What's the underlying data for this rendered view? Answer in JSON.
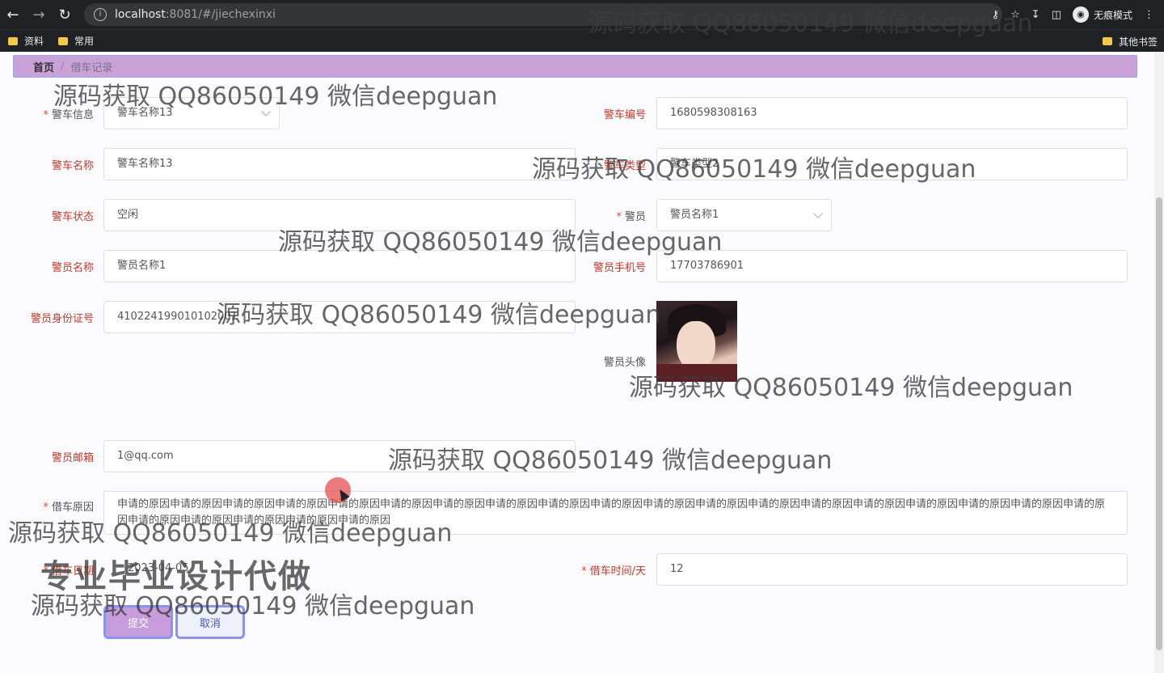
{
  "browser": {
    "url_host": "localhost",
    "url_path": ":8081/#/jiechexinxi",
    "incognito_label": "无痕模式",
    "bookmarks": [
      "资料",
      "常用"
    ],
    "other_bookmarks": "其他书签"
  },
  "breadcrumb": {
    "home": "首页",
    "separator": "/",
    "current": "借车记录"
  },
  "form": {
    "police_car_info": {
      "label": "警车信息",
      "value": "警车名称13"
    },
    "police_car_number": {
      "label": "警车编号",
      "value": "1680598308163"
    },
    "police_car_name": {
      "label": "警车名称",
      "value": "警车名称13"
    },
    "police_car_type": {
      "label": "警车类型",
      "value": "警车类型2"
    },
    "police_car_status": {
      "label": "警车状态",
      "value": "空闲"
    },
    "officer": {
      "label": "警员",
      "value": "警员名称1"
    },
    "officer_name": {
      "label": "警员名称",
      "value": "警员名称1"
    },
    "officer_phone": {
      "label": "警员手机号",
      "value": "17703786901"
    },
    "officer_id_number": {
      "label": "警员身份证号",
      "value": "410224199010102001"
    },
    "officer_avatar": {
      "label": "警员头像"
    },
    "officer_email": {
      "label": "警员邮箱",
      "value": "1@qq.com"
    },
    "borrow_reason": {
      "label": "借车原因",
      "value": "申请的原因申请的原因申请的原因申请的原因申请的原因申请的原因申请的原因申请的原因申请的原因申请的原因申请的原因申请的原因申请的原因申请的原因申请的原因申请的原因申请的原因申请的原因申请的原因申请的原因申请的原因申请的原因申请的原因申请的原因"
    },
    "borrow_date": {
      "label": "借车日期",
      "value": "2023-04-05"
    },
    "borrow_days": {
      "label": "借车时间/天",
      "value": "12"
    }
  },
  "buttons": {
    "submit": "提交",
    "cancel": "取消"
  },
  "overlay": {
    "watermark": "源码获取 QQ86050149 微信deepguan",
    "promo": "专业毕业设计代做"
  }
}
